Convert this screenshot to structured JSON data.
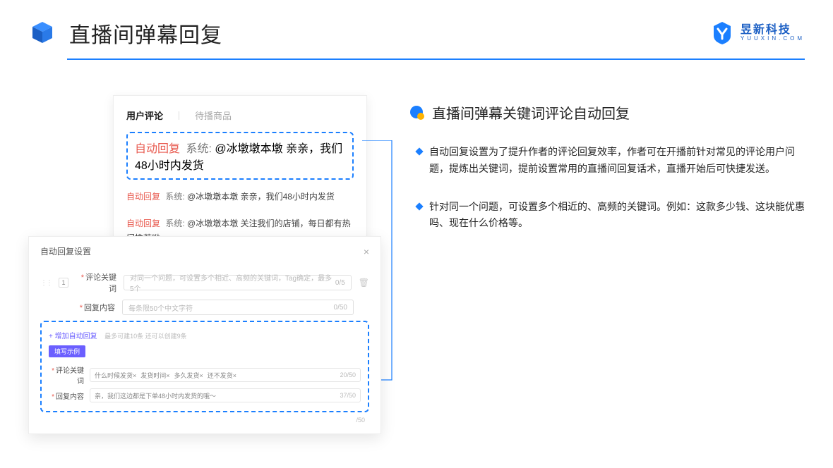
{
  "header": {
    "title": "直播间弹幕回复",
    "logo_main": "昱新科技",
    "logo_sub": "YUUXIN.COM"
  },
  "comments": {
    "tab_active": "用户评论",
    "tab_inactive": "待播商品",
    "items": [
      {
        "tag": "自动回复",
        "sys": "系统:",
        "text": "@冰墩墩本墩 亲亲，我们48小时内发货"
      },
      {
        "tag": "自动回复",
        "sys": "系统:",
        "text": "@冰墩墩本墩 亲亲，我们48小时内发货"
      },
      {
        "tag": "自动回复",
        "sys": "系统:",
        "text": "@冰墩墩本墩 关注我们的店铺，每日都有热门推荐呦～"
      }
    ]
  },
  "settings": {
    "title": "自动回复设置",
    "row_num": "1",
    "field1_label": "评论关键词",
    "field1_placeholder": "对同一个问题，可设置多个相近、高频的关键词，Tag确定，最多5个",
    "field1_count": "0/5",
    "field2_label": "回复内容",
    "field2_placeholder": "每条限50个中文字符",
    "field2_count": "0/50",
    "add_link": "+ 增加自动回复",
    "add_hint": "最多可建10条 还可以创建9条",
    "badge": "填写示例",
    "ex1_label": "评论关键词",
    "ex1_tags": [
      "什么时候发货×",
      "发货时间×",
      "多久发货×",
      "还不发货×"
    ],
    "ex1_count": "20/50",
    "ex2_label": "回复内容",
    "ex2_value": "亲，我们这边都是下单48小时内发货的哦～",
    "ex2_count": "37/50",
    "bottom_count": "/50"
  },
  "right": {
    "title": "直播间弹幕关键词评论自动回复",
    "bullets": [
      "自动回复设置为了提升作者的评论回复效率，作者可在开播前针对常见的评论用户问题，提炼出关键词，提前设置常用的直播间回复话术，直播开始后可快捷发送。",
      "针对同一个问题，可设置多个相近的、高频的关键词。例如：这款多少钱、这块能优惠吗、现在什么价格等。"
    ]
  }
}
